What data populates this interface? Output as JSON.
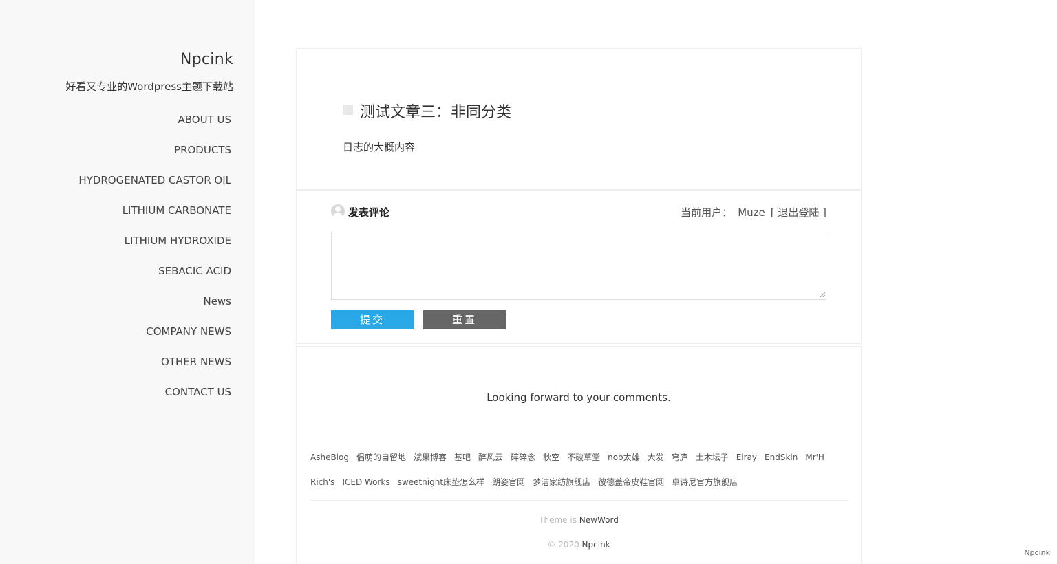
{
  "site": {
    "title": "Npcink",
    "description": "好看又专业的Wordpress主题下载站"
  },
  "nav": [
    {
      "label": "ABOUT US"
    },
    {
      "label": "PRODUCTS"
    },
    {
      "label": "HYDROGENATED CASTOR OIL"
    },
    {
      "label": "LITHIUM CARBONATE"
    },
    {
      "label": "LITHIUM HYDROXIDE"
    },
    {
      "label": "SEBACIC ACID"
    },
    {
      "label": "News"
    },
    {
      "label": "COMPANY NEWS"
    },
    {
      "label": "OTHER NEWS"
    },
    {
      "label": "CONTACT US"
    }
  ],
  "post": {
    "title": "测试文章三：非同分类",
    "excerpt": "日志的大概内容"
  },
  "comment": {
    "heading": "发表评论",
    "current_user_label": "当前用户：",
    "user_name": "Muze",
    "logout": "[ 退出登陆 ]",
    "textarea_value": "",
    "submit_label": "提交",
    "reset_label": "重置"
  },
  "footer": {
    "tagline": "Looking forward to your comments.",
    "links_row1": [
      "AsheBlog",
      "倡萌的自留地",
      "斌果博客",
      "基吧",
      "醉风云",
      "碎碎念",
      "秋空",
      "不破草堂",
      "nob太雄",
      "大发",
      "穹庐",
      "土木坛子",
      "Eiray",
      "EndSkin",
      "Mr'H"
    ],
    "links_row2": [
      "Rich's",
      "ICED Works",
      "sweetnight床垫怎么样",
      "朗姿官网",
      "梦洁家纺旗舰店",
      "彼德盖帝皮鞋官网",
      "卓诗尼官方旗舰店"
    ],
    "theme_prefix": "Theme is",
    "theme_name": "NewWord",
    "copyright_prefix": "© 2020",
    "copyright_name": "Npcink"
  },
  "corner_label": "Npcink"
}
